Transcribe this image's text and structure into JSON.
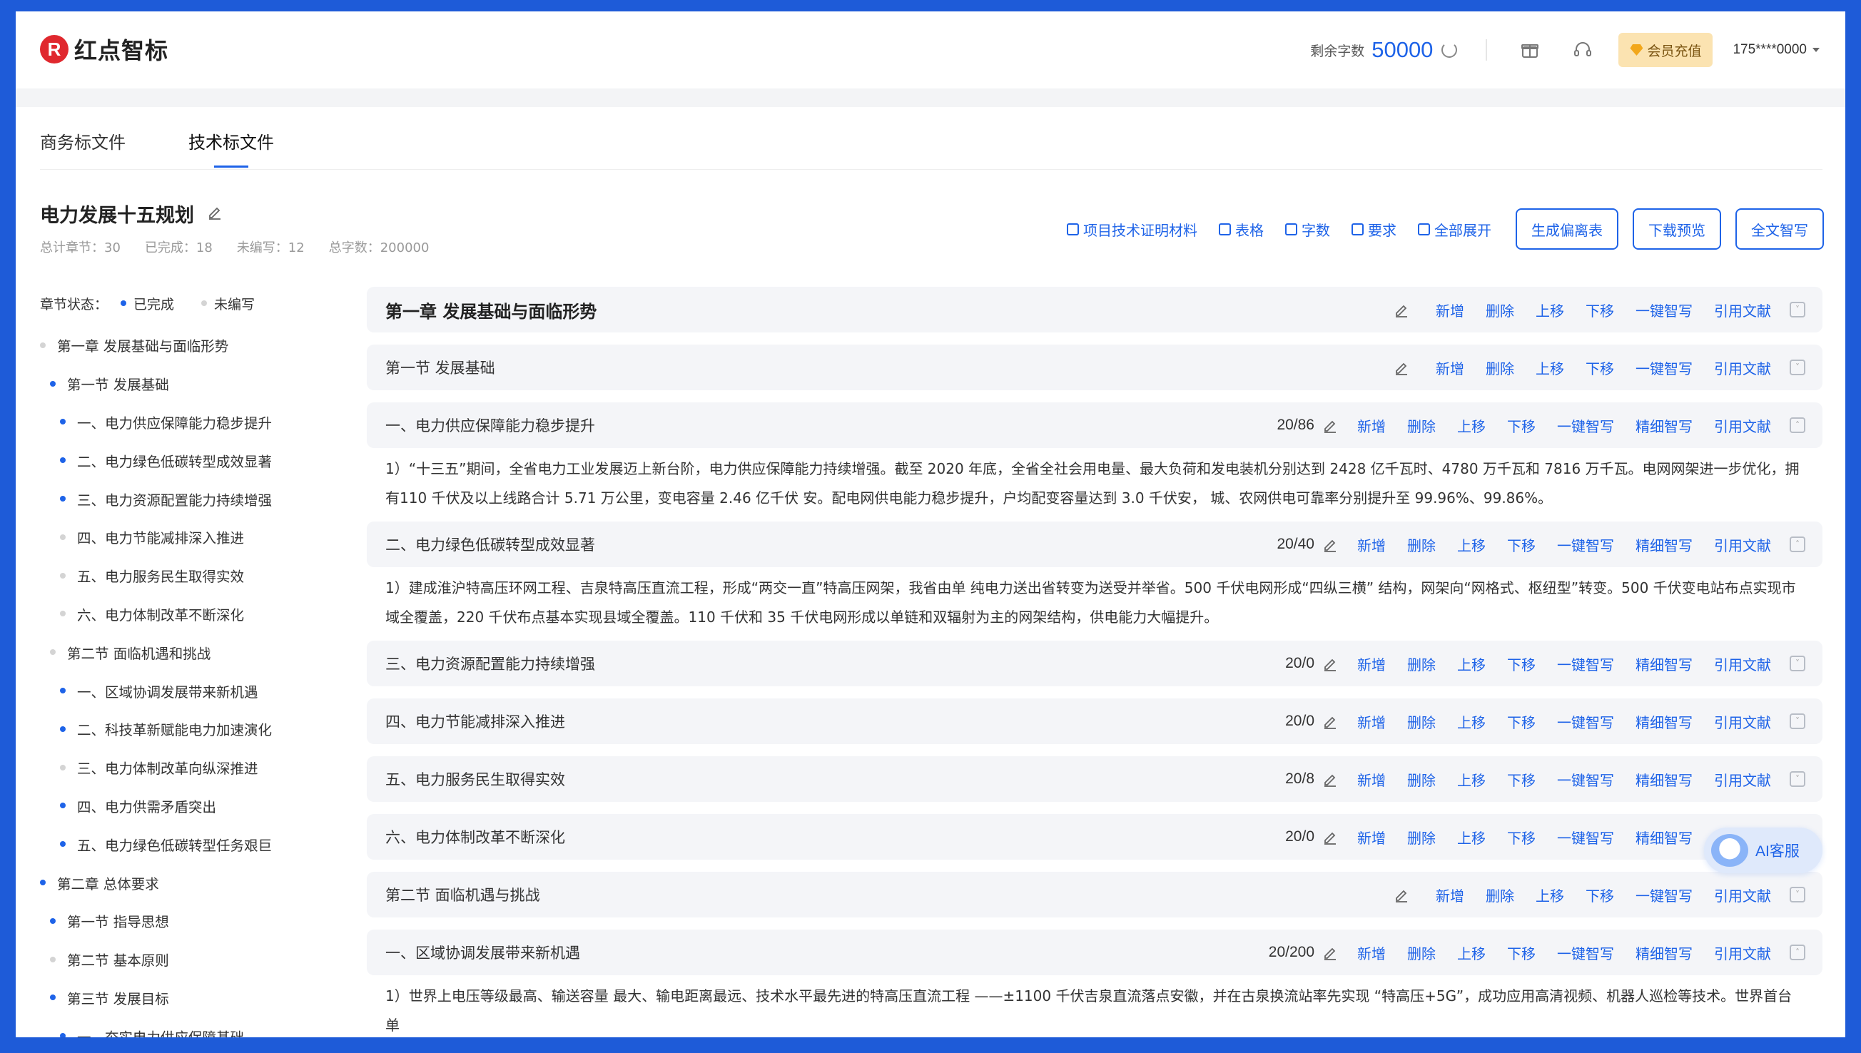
{
  "header": {
    "logo_text": "红点智标",
    "logo_mark": "R",
    "remain_label": "剩余字数",
    "remain_value": "50000",
    "vip_button": "会员充值",
    "phone": "175****0000"
  },
  "tabs": [
    {
      "label": "商务标文件",
      "active": false
    },
    {
      "label": "技术标文件",
      "active": true
    }
  ],
  "project": {
    "title": "电力发展十五规划",
    "stats": {
      "total": "总计章节：30",
      "done": "已完成：18",
      "todo": "未编写：12",
      "words": "总字数：200000"
    }
  },
  "toolbar": {
    "links": [
      "项目技术证明材料",
      "表格",
      "字数",
      "要求",
      "全部展开"
    ],
    "buttons": [
      "生成偏离表",
      "下载预览",
      "全文智写"
    ]
  },
  "sidebar": {
    "legend_label": "章节状态：",
    "legend_done": "已完成",
    "legend_todo": "未编写",
    "items": [
      {
        "label": "第一章   发展基础与面临形势",
        "level": 1,
        "done": false
      },
      {
        "label": "第一节   发展基础",
        "level": 2,
        "done": true
      },
      {
        "label": "一、电力供应保障能力稳步提升",
        "level": 3,
        "done": true
      },
      {
        "label": "二、电力绿色低碳转型成效显著",
        "level": 3,
        "done": true
      },
      {
        "label": "三、电力资源配置能力持续增强",
        "level": 3,
        "done": true
      },
      {
        "label": "四、电力节能减排深入推进",
        "level": 3,
        "done": false
      },
      {
        "label": "五、电力服务民生取得实效",
        "level": 3,
        "done": false
      },
      {
        "label": "六、电力体制改革不断深化",
        "level": 3,
        "done": false
      },
      {
        "label": "第二节   面临机遇和挑战",
        "level": 2,
        "done": false
      },
      {
        "label": "一、区域协调发展带来新机遇",
        "level": 3,
        "done": true
      },
      {
        "label": "二、科技革新赋能电力加速演化",
        "level": 3,
        "done": true
      },
      {
        "label": "三、电力体制改革向纵深推进",
        "level": 3,
        "done": false
      },
      {
        "label": "四、电力供需矛盾突出",
        "level": 3,
        "done": true
      },
      {
        "label": "五、电力绿色低碳转型任务艰巨",
        "level": 3,
        "done": true
      },
      {
        "label": "第二章   总体要求",
        "level": 1,
        "done": true
      },
      {
        "label": "第一节   指导思想",
        "level": 2,
        "done": true
      },
      {
        "label": "第二节   基本原则",
        "level": 2,
        "done": false
      },
      {
        "label": "第三节   发展目标",
        "level": 2,
        "done": true
      },
      {
        "label": "一、夯实电力供应保障基础",
        "level": 3,
        "done": true
      }
    ]
  },
  "actions": {
    "add": "新增",
    "delete": "删除",
    "up": "上移",
    "down": "下移",
    "smart": "一键智写",
    "fine": "精细智写",
    "cite": "引用文献"
  },
  "rows": [
    {
      "type": "chapter",
      "title": "第一章   发展基础与面临形势",
      "count": ""
    },
    {
      "type": "section",
      "title": "第一节   发展基础",
      "count": ""
    },
    {
      "type": "item",
      "title": "一、电力供应保障能力稳步提升",
      "count": "20/86",
      "expanded": true,
      "content": "1）“十三五”期间，全省电力工业发展迈上新台阶，电力供应保障能力持续增强。截至 2020 年底，全省全社会用电量、最大负荷和发电装机分别达到 2428 亿千瓦时、4780 万千瓦和 7816 万千瓦。电网网架进一步优化，拥有110 千伏及以上线路合计 5.71 万公里，变电容量 2.46 亿千伏 安。配电网供电能力稳步提升，户均配变容量达到 3.0 千伏安，  城、农网供电可靠率分别提升至 99.96%、99.86%。"
    },
    {
      "type": "item",
      "title": "二、电力绿色低碳转型成效显著",
      "count": "20/40",
      "expanded": true,
      "content": "1）建成淮沪特高压环网工程、吉泉特高压直流工程，形成“两交一直”特高压网架，我省由单 纯电力送出省转变为送受并举省。500 千伏电网形成“四纵三横” 结构，网架向“网格式、枢纽型”转变。500 千伏变电站布点实现市域全覆盖，220 千伏布点基本实现县域全覆盖。110 千伏和 35 千伏电网形成以单链和双辐射为主的网架结构，供电能力大幅提升。"
    },
    {
      "type": "item",
      "title": "三、电力资源配置能力持续增强",
      "count": "20/0",
      "expanded": false
    },
    {
      "type": "item",
      "title": "四、电力节能减排深入推进",
      "count": "20/0",
      "expanded": false
    },
    {
      "type": "item",
      "title": "五、电力服务民生取得实效",
      "count": "20/8",
      "expanded": false
    },
    {
      "type": "item",
      "title": "六、电力体制改革不断深化",
      "count": "20/0",
      "expanded": false
    },
    {
      "type": "section",
      "title": "第二节   面临机遇与挑战",
      "count": ""
    },
    {
      "type": "item",
      "title": "一、区域协调发展带来新机遇",
      "count": "20/200",
      "expanded": true,
      "content": "1）世界上电压等级最高、输送容量 最大、输电距离最远、技术水平最先进的特高压直流工程 ——±1100 千伏吉泉直流落点安徽，并在古泉换流站率先实现 “特高压+5G”，成功应用高清视频、机器人巡检等技术。世界首台单"
    }
  ],
  "ai_service": "AI客服",
  "colors": {
    "accent": "#1e63e8",
    "frame": "#1e5bd8",
    "brand_red": "#e0282e",
    "vip_bg": "#fbe3b1"
  },
  "icons": [
    "refresh-icon",
    "gift-icon",
    "headset-icon",
    "gem-icon",
    "pencil-icon",
    "collapse-icon",
    "caret-down-icon"
  ]
}
